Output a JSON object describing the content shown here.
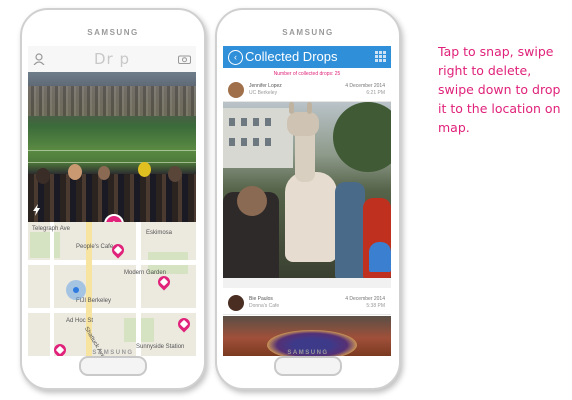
{
  "phones": {
    "brand": "SAMSUNG"
  },
  "left_screen": {
    "logo": "Dr p",
    "map_labels": {
      "street1": "Telegraph Ave",
      "peoples": "People's Cafe",
      "eskimosa": "Eskimosa",
      "modern": "Modern Garden",
      "berkeley": "FIJI Berkeley",
      "shattuck": "Shattuck Ave",
      "ad_hoc": "Ad Hoc St",
      "sunnyside": "Sunnyside Station"
    }
  },
  "right_screen": {
    "title": "Collected Drops",
    "count_label": "Number of collected drops: 25",
    "cards": [
      {
        "name": "Jennifer Lopez",
        "place": "UC Berkeley",
        "date": "4 December 2014",
        "time": "6:21 PM"
      },
      {
        "name": "Bie Paulos",
        "place": "Donna's Cafe",
        "date": "4 December 2014",
        "time": "5:38 PM"
      }
    ]
  },
  "caption": "Tap to snap, swipe right to delete, swipe down to drop it to the location on map.",
  "colors": {
    "accent": "#e0227a",
    "appbar": "#2f8fd9"
  }
}
